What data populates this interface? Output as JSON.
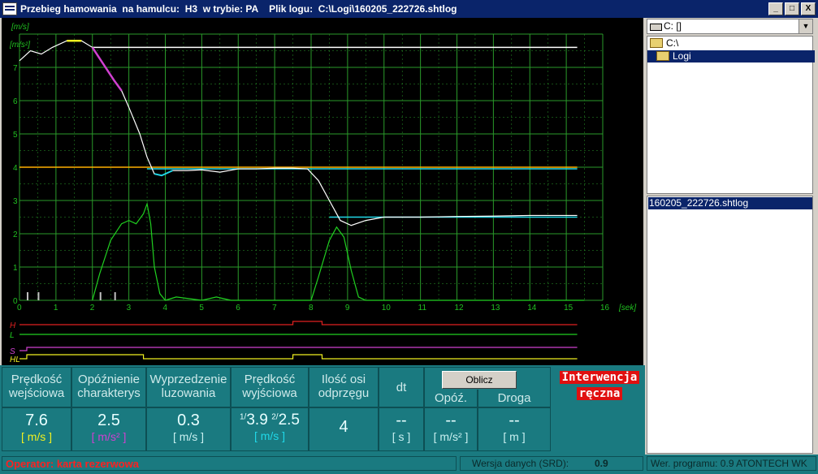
{
  "window": {
    "title": "Przebieg hamowania  na hamulcu:  H3  w trybie: PA    Plik logu:  C:\\Logi\\160205_222726.shtlog",
    "btn_min": "_",
    "btn_max": "□",
    "btn_close": "X"
  },
  "chart": {
    "y_unit_top": "[m/s]",
    "y_unit_second": "[m/s²]",
    "x_unit": "[sek]",
    "y_ticks": [
      "0",
      "1",
      "2",
      "3",
      "4",
      "5",
      "6",
      "7"
    ],
    "x_ticks": [
      "0",
      "1",
      "2",
      "3",
      "4",
      "5",
      "6",
      "7",
      "8",
      "9",
      "10",
      "11",
      "12",
      "13",
      "14",
      "15",
      "16"
    ],
    "signal_labels": [
      "H",
      "L",
      "S",
      "HL"
    ]
  },
  "chart_data": {
    "type": "line",
    "x_range": [
      0,
      16
    ],
    "y_range": [
      0,
      8
    ],
    "grid": true,
    "speed_white": [
      [
        0,
        7.2
      ],
      [
        0.3,
        7.5
      ],
      [
        0.6,
        7.4
      ],
      [
        0.9,
        7.6
      ],
      [
        1.3,
        7.8
      ],
      [
        1.7,
        7.8
      ],
      [
        2.0,
        7.6
      ],
      [
        2.3,
        7.1
      ],
      [
        2.6,
        6.6
      ],
      [
        2.8,
        6.3
      ],
      [
        3.0,
        5.8
      ],
      [
        3.3,
        5.0
      ],
      [
        3.5,
        4.3
      ],
      [
        3.7,
        3.8
      ],
      [
        3.9,
        3.75
      ],
      [
        4.2,
        3.9
      ],
      [
        4.6,
        3.9
      ],
      [
        5.0,
        3.92
      ],
      [
        5.5,
        3.85
      ],
      [
        6.0,
        3.95
      ],
      [
        6.5,
        3.95
      ],
      [
        7.0,
        3.97
      ],
      [
        7.5,
        3.97
      ],
      [
        7.9,
        3.95
      ],
      [
        8.2,
        3.6
      ],
      [
        8.5,
        3.0
      ],
      [
        8.8,
        2.4
      ],
      [
        9.1,
        2.25
      ],
      [
        9.5,
        2.4
      ],
      [
        10.0,
        2.5
      ],
      [
        11,
        2.5
      ],
      [
        12,
        2.52
      ],
      [
        13,
        2.53
      ],
      [
        14,
        2.55
      ],
      [
        15.3,
        2.55
      ]
    ],
    "accel_green": [
      [
        2.0,
        0
      ],
      [
        2.2,
        0.8
      ],
      [
        2.5,
        1.8
      ],
      [
        2.8,
        2.3
      ],
      [
        3.0,
        2.4
      ],
      [
        3.2,
        2.3
      ],
      [
        3.4,
        2.6
      ],
      [
        3.5,
        2.9
      ],
      [
        3.6,
        2.3
      ],
      [
        3.7,
        1.0
      ],
      [
        3.85,
        0.2
      ],
      [
        4.0,
        0
      ],
      [
        4.3,
        0.1
      ],
      [
        5.0,
        0.0
      ],
      [
        5.4,
        0.1
      ],
      [
        5.8,
        0
      ],
      [
        8.0,
        0
      ],
      [
        8.2,
        0.7
      ],
      [
        8.5,
        1.8
      ],
      [
        8.7,
        2.2
      ],
      [
        8.9,
        1.9
      ],
      [
        9.1,
        0.9
      ],
      [
        9.3,
        0.1
      ],
      [
        9.5,
        0
      ],
      [
        15.5,
        0
      ]
    ],
    "setpoint_orange": {
      "y": 4.0,
      "x": [
        0,
        15.3
      ]
    },
    "setpoint_cyan_1": {
      "y": 3.95,
      "x": [
        3.5,
        15.3
      ]
    },
    "setpoint_cyan_2": {
      "y": 2.5,
      "x": [
        8.5,
        15.3
      ]
    },
    "setpoint_white_top": {
      "y": 7.6,
      "x": [
        2.0,
        15.3
      ]
    }
  },
  "colors": {
    "grid": "#2a9a2a",
    "axis_text": "#20c020",
    "speed": "#ffffff",
    "accel": "#20d020",
    "orange": "#ffb000",
    "cyan": "#20d8e8",
    "magenta": "#d040d0",
    "yellow": "#f0f020",
    "red": "#e02020"
  },
  "panel": {
    "col1_hdr": "Prędkość wejściowa",
    "col1_val": "7.6",
    "col1_unit": "[ m/s ]",
    "col2_hdr": "Opóźnienie charakterys",
    "col2_val": "2.5",
    "col2_unit": "[ m/s² ]",
    "col3_hdr": "Wyprzedzenie luzowania",
    "col3_val": "0.3",
    "col3_unit": "[ m/s ]",
    "col4_hdr": "Prędkość wyjściowa",
    "col4_sup1": "1/",
    "col4_val1": "3.9",
    "col4_sup2": "2/",
    "col4_val2": "2.5",
    "col4_unit": "[ m/s ]",
    "col5_hdr": "Ilość osi odprzęgu",
    "col5_val": "4",
    "col6_hdr": "dt",
    "col6_val": "--",
    "col6_unit": "[ s ]",
    "calc_button": "Oblicz",
    "col7_hdr": "Opóź.",
    "col7_val": "--",
    "col7_unit": "[ m/s² ]",
    "col8_hdr": "Droga",
    "col8_val": "--",
    "col8_unit": "[ m ]",
    "intervention_line1": "Interwencja",
    "intervention_line2": "ręczna"
  },
  "status": {
    "operator": "Operator: karta rezerwowa",
    "data_version_label": "Wersja danych (SRD):",
    "data_version_value": "0.9",
    "program_version": "Wer. programu: 0.9  ATONTECH WK"
  },
  "files": {
    "drive": "C: []",
    "dirs": [
      "C:\\",
      "Logi"
    ],
    "selected_file": "160205_222726.shtlog"
  }
}
